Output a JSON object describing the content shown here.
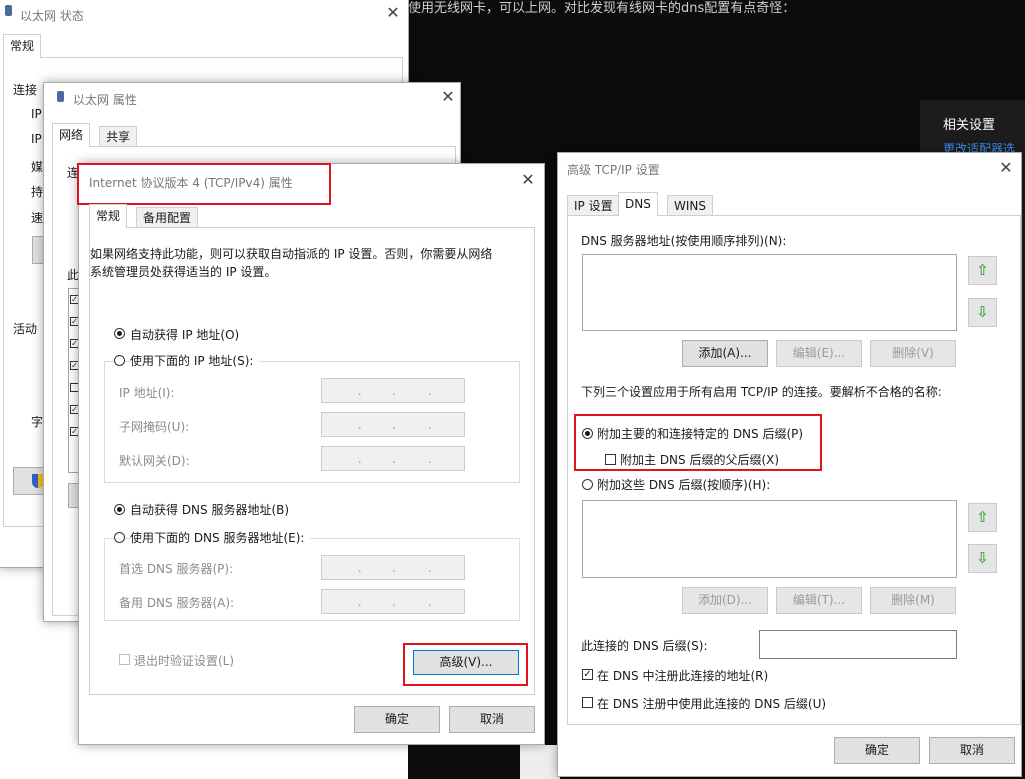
{
  "terminal": {
    "text": "使用无线网卡，可以上网。对比发现有线网卡的dns配置有点奇怪："
  },
  "settings_panel": {
    "heading": "相关设置",
    "link": "更改适配器选"
  },
  "eth_status": {
    "title": "以太网 状态",
    "tab_general": "常规",
    "section_connection": "连接",
    "row_ipv4": "IP",
    "row_ipv6": "IP",
    "row_media": "媒",
    "row_duration": "持",
    "row_speed": "速",
    "section_activity": "活动",
    "row_bytes": "字"
  },
  "eth_props": {
    "title": "以太网 属性",
    "tab_network": "网络",
    "tab_sharing": "共享",
    "row_connect": "连",
    "row_items": "此"
  },
  "ipv4": {
    "title": "Internet 协议版本 4 (TCP/IPv4) 属性",
    "tab_general": "常规",
    "tab_alternate": "备用配置",
    "description": "如果网络支持此功能，则可以获取自动指派的 IP 设置。否则，你需要从网络系统管理员处获得适当的 IP 设置。",
    "radio_auto_ip": "自动获得 IP 地址(O)",
    "radio_manual_ip": "使用下面的 IP 地址(S):",
    "label_ip": "IP 地址(I):",
    "label_mask": "子网掩码(U):",
    "label_gateway": "默认网关(D):",
    "radio_auto_dns": "自动获得 DNS 服务器地址(B)",
    "radio_manual_dns": "使用下面的 DNS 服务器地址(E):",
    "label_pref_dns": "首选 DNS 服务器(P):",
    "label_alt_dns": "备用 DNS 服务器(A):",
    "ip_dots": ".",
    "checkbox_validate": "退出时验证设置(L)",
    "button_advanced": "高级(V)...",
    "button_ok": "确定",
    "button_cancel": "取消"
  },
  "advanced": {
    "title": "高级 TCP/IP 设置",
    "tab_ip": "IP 设置",
    "tab_dns": "DNS",
    "tab_wins": "WINS",
    "dns_servers_label": "DNS 服务器地址(按使用顺序排列)(N):",
    "up_arrow": "⇧",
    "down_arrow": "⇩",
    "button_add_1": "添加(A)...",
    "button_edit_1": "编辑(E)...",
    "button_remove_1": "删除(V)",
    "note": "下列三个设置应用于所有启用 TCP/IP 的连接。要解析不合格的名称:",
    "radio_primary": "附加主要的和连接特定的 DNS 后缀(P)",
    "check_parent": "附加主 DNS 后缀的父后缀(X)",
    "radio_these": "附加这些 DNS 后缀(按顺序)(H):",
    "button_add_2": "添加(D)...",
    "button_edit_2": "编辑(T)...",
    "button_remove_2": "删除(M)",
    "suffix_label": "此连接的 DNS 后缀(S):",
    "suffix_value": "",
    "check_register": "在 DNS 中注册此连接的地址(R)",
    "check_register_suffix": "在 DNS 注册中使用此连接的 DNS 后缀(U)",
    "check_mark": "✓",
    "button_ok": "确定",
    "button_cancel": "取消"
  },
  "colors": {
    "highlight": "#e0141e",
    "terminal_bg": "#0c0c0c",
    "link": "#3c8ee8"
  }
}
